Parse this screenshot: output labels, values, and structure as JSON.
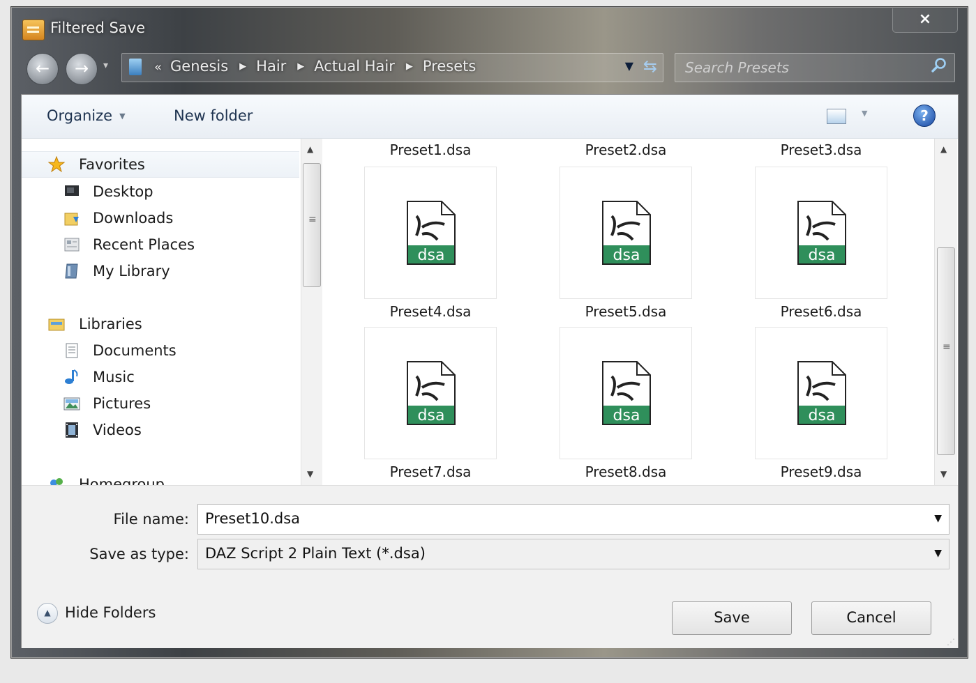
{
  "window": {
    "title": "Filtered Save",
    "close_label": "×"
  },
  "nav": {
    "back": "←",
    "forward": "→",
    "breadcrumb": [
      "Genesis",
      "Hair",
      "Actual Hair",
      "Presets"
    ],
    "overflow": "«",
    "search_placeholder": "Search Presets"
  },
  "toolbar": {
    "organize": "Organize",
    "new_folder": "New folder",
    "help": "?"
  },
  "sidebar": {
    "favorites": {
      "label": "Favorites",
      "items": [
        "Desktop",
        "Downloads",
        "Recent Places",
        "My Library"
      ]
    },
    "libraries": {
      "label": "Libraries",
      "items": [
        "Documents",
        "Music",
        "Pictures",
        "Videos"
      ]
    },
    "homegroup": "Homegroup"
  },
  "files": {
    "top_row_labels": [
      "Preset1.dsa",
      "Preset2.dsa",
      "Preset3.dsa"
    ],
    "tiles": [
      {
        "label": "Preset4.dsa",
        "ext": "dsa"
      },
      {
        "label": "Preset5.dsa",
        "ext": "dsa"
      },
      {
        "label": "Preset6.dsa",
        "ext": "dsa"
      },
      {
        "label": "Preset7.dsa",
        "ext": "dsa"
      },
      {
        "label": "Preset8.dsa",
        "ext": "dsa"
      },
      {
        "label": "Preset9.dsa",
        "ext": "dsa"
      }
    ]
  },
  "form": {
    "file_name_label": "File name:",
    "file_name_value": "Preset10.dsa",
    "type_label": "Save as type:",
    "type_value": "DAZ Script 2 Plain Text (*.dsa)"
  },
  "footer": {
    "hide_folders": "Hide Folders",
    "save": "Save",
    "cancel": "Cancel"
  },
  "colors": {
    "dsa_band": "#2f8f5b",
    "accent": "#1e3350"
  }
}
